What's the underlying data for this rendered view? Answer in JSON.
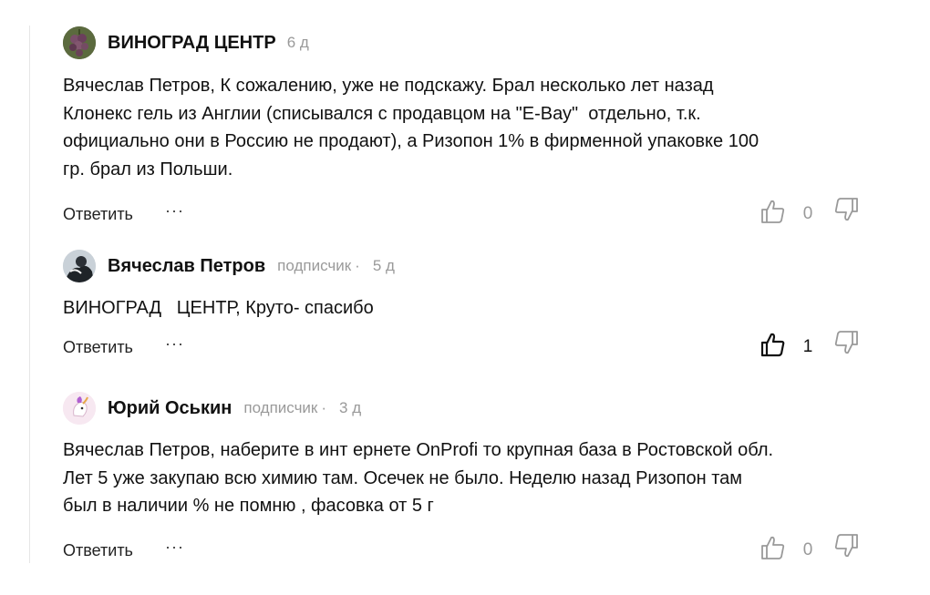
{
  "actions": {
    "reply_label": "Ответить",
    "more_label": "···"
  },
  "comments": [
    {
      "author": "ВИНОГРАД ЦЕНТР",
      "badge": "",
      "age": "6 д",
      "text": "Вячеслав Петров, К сожалению, уже не подскажу. Брал несколько лет назад\nКлонекс гель из Англии (списывался с продавцом на \"Е-Вау\"  отдельно, т.к.\nофициально они в Россию не продают), а Ризопон 1% в фирменной упаковке 100\nгр. брал из Польши.",
      "likes": "0"
    },
    {
      "author": "Вячеслав Петров",
      "badge": "подписчик",
      "separator": "·",
      "age": "5 д",
      "text": "ВИНОГРАД   ЦЕНТР, Круто- спасибо",
      "likes": "1"
    },
    {
      "author": "Юрий Оськин",
      "badge": "подписчик",
      "separator": "·",
      "age": "3 д",
      "text": "Вячеслав Петров, наберите в инт ернете OnProfi то крупная база в Ростовской обл.\nЛет 5 уже закупаю всю химию там. Осечек не было. Неделю назад Ризопон там\nбыл в наличии % не помню , фасовка от 5 г",
      "likes": "0"
    }
  ]
}
